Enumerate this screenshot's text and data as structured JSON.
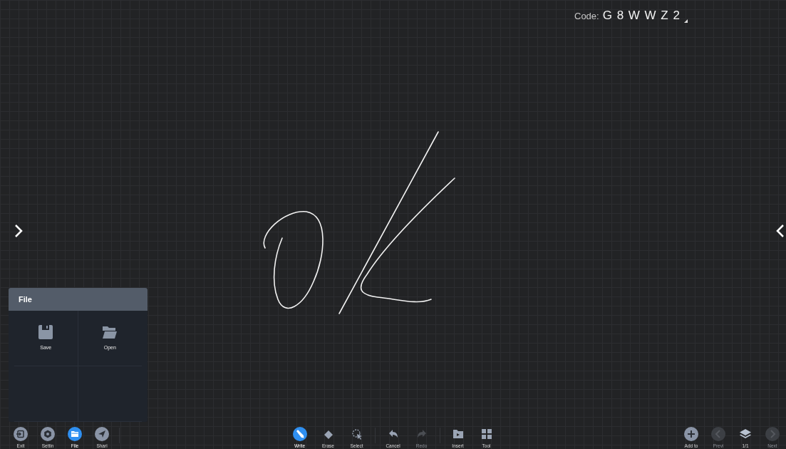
{
  "code": {
    "label": "Code:",
    "value": "G 8 W W Z 2"
  },
  "file_panel": {
    "title": "File",
    "items": [
      {
        "label": "Save"
      },
      {
        "label": "Open"
      }
    ]
  },
  "left_tools": [
    {
      "label": "Exit",
      "selected": false
    },
    {
      "label": "Settin",
      "selected": false
    },
    {
      "label": "File",
      "selected": true
    },
    {
      "label": "Shari",
      "selected": false
    }
  ],
  "center_tools": [
    {
      "label": "Write",
      "selected": true,
      "disabled": false
    },
    {
      "label": "Erase",
      "selected": false,
      "disabled": false
    },
    {
      "label": "Select",
      "selected": false,
      "disabled": false
    },
    {
      "label": "Cancel",
      "selected": false,
      "disabled": false
    },
    {
      "label": "Redo",
      "selected": false,
      "disabled": true
    },
    {
      "label": "Insert",
      "selected": false,
      "disabled": false
    },
    {
      "label": "Tool",
      "selected": false,
      "disabled": false
    }
  ],
  "right_tools": [
    {
      "label": "Add to",
      "disabled": false
    },
    {
      "label": "Previ",
      "disabled": true
    },
    {
      "label": "1/1",
      "disabled": false
    },
    {
      "label": "Next",
      "disabled": true
    }
  ]
}
